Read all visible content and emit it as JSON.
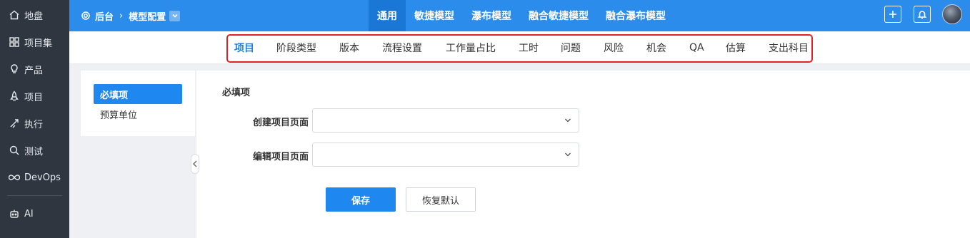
{
  "sidebar": {
    "items": [
      {
        "label": "地盘",
        "icon": "home-icon"
      },
      {
        "label": "项目集",
        "icon": "grid-icon"
      },
      {
        "label": "产品",
        "icon": "lightbulb-icon"
      },
      {
        "label": "项目",
        "icon": "rocket-icon"
      },
      {
        "label": "执行",
        "icon": "run-icon"
      },
      {
        "label": "测试",
        "icon": "search-icon"
      },
      {
        "label": "DevOps",
        "icon": "infinity-icon"
      },
      {
        "label": "AI",
        "icon": "robot-icon"
      }
    ]
  },
  "header": {
    "breadcrumb": {
      "root": "后台",
      "current": "模型配置"
    },
    "tabs": [
      {
        "label": "通用",
        "active": true
      },
      {
        "label": "敏捷模型",
        "active": false
      },
      {
        "label": "瀑布模型",
        "active": false
      },
      {
        "label": "融合敏捷模型",
        "active": false
      },
      {
        "label": "融合瀑布模型",
        "active": false
      }
    ],
    "accent_color": "#2b8cec"
  },
  "subnav": {
    "tabs": [
      {
        "label": "项目",
        "active": true
      },
      {
        "label": "阶段类型",
        "active": false
      },
      {
        "label": "版本",
        "active": false
      },
      {
        "label": "流程设置",
        "active": false
      },
      {
        "label": "工作量占比",
        "active": false
      },
      {
        "label": "工时",
        "active": false
      },
      {
        "label": "问题",
        "active": false
      },
      {
        "label": "风险",
        "active": false
      },
      {
        "label": "机会",
        "active": false
      },
      {
        "label": "QA",
        "active": false
      },
      {
        "label": "估算",
        "active": false
      },
      {
        "label": "支出科目",
        "active": false
      }
    ],
    "highlight_color": "#e41f26"
  },
  "left_panel": {
    "items": [
      {
        "label": "必填项",
        "active": true
      },
      {
        "label": "预算单位",
        "active": false
      }
    ]
  },
  "form": {
    "section_title": "必填项",
    "fields": [
      {
        "label": "创建项目页面",
        "value": ""
      },
      {
        "label": "编辑项目页面",
        "value": ""
      }
    ],
    "save_label": "保存",
    "reset_label": "恢复默认"
  }
}
